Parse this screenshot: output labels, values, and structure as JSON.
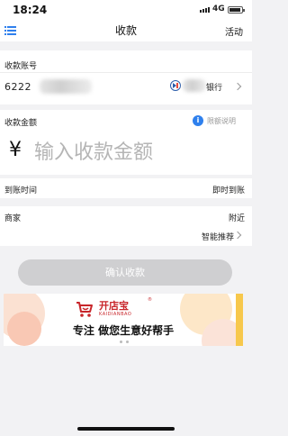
{
  "status_bar": {
    "time": "18:24",
    "network": "4G"
  },
  "nav": {
    "title": "收款",
    "right_action": "活动"
  },
  "account": {
    "label": "收款账号",
    "number_prefix": "6222",
    "bank_suffix": "银行"
  },
  "amount": {
    "label": "收款金额",
    "limit_link": "限额说明",
    "currency_symbol": "¥",
    "placeholder": "输入收款金额"
  },
  "arrival": {
    "label": "到账时间",
    "value": "即时到账"
  },
  "merchant": {
    "label": "商家",
    "value": "附近",
    "recommend": "智能推荐"
  },
  "confirm_button": "确认收款",
  "banner": {
    "brand_cn": "开店宝",
    "brand_en": "KAIDIANBAO",
    "slogan": "专注 做您生意好帮手",
    "colors": {
      "brand": "#c8262b"
    }
  },
  "colors": {
    "accent": "#2f80ed",
    "button_disabled": "#cfcfd1",
    "background": "#f2f2f4"
  }
}
